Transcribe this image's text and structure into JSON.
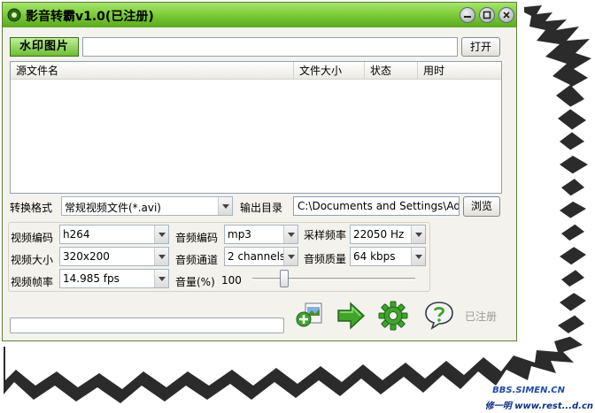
{
  "window": {
    "title": "影音转霸v1.0(已注册)"
  },
  "top_row": {
    "watermark_label": "水印图片",
    "watermark_path": "",
    "open_button": "打开"
  },
  "file_list": {
    "columns": [
      "源文件名",
      "文件大小",
      "状态",
      "用时"
    ],
    "rows": []
  },
  "format_row": {
    "format_label": "转换格式",
    "format_value": "常规视频文件(*.avi)",
    "output_dir_label": "输出目录",
    "output_dir_value": "C:\\Documents and Settings\\Adm",
    "browse_button": "浏览"
  },
  "settings": {
    "video_codec_label": "视频编码",
    "video_codec_value": "h264",
    "video_size_label": "视频大小",
    "video_size_value": "320x200",
    "frame_rate_label": "视频帧率",
    "frame_rate_value": "14.985 fps",
    "audio_codec_label": "音频编码",
    "audio_codec_value": "mp3",
    "audio_channel_label": "音频通道",
    "audio_channel_value": "2 channels",
    "volume_label": "音量(%)",
    "volume_value": "100",
    "volume_level": 0.18,
    "sample_rate_label": "采样频率",
    "sample_rate_value": "22050 Hz",
    "audio_quality_label": "音频质量",
    "audio_quality_value": "64 kbps"
  },
  "progress": {
    "fraction": 0.0
  },
  "actions": {
    "add_file_icon": "add-file-icon",
    "start_icon": "arrow-right-icon",
    "settings_icon": "gear-icon",
    "help_icon": "help-icon",
    "registered_label": "已注册"
  },
  "site_logo": {
    "top_text": "BBS.SIMEN.CN",
    "bottom_text": "修一明 www.rest...d.cn"
  },
  "colors": {
    "title_green": "#7fce3c",
    "action_green": "#3fa32c"
  }
}
